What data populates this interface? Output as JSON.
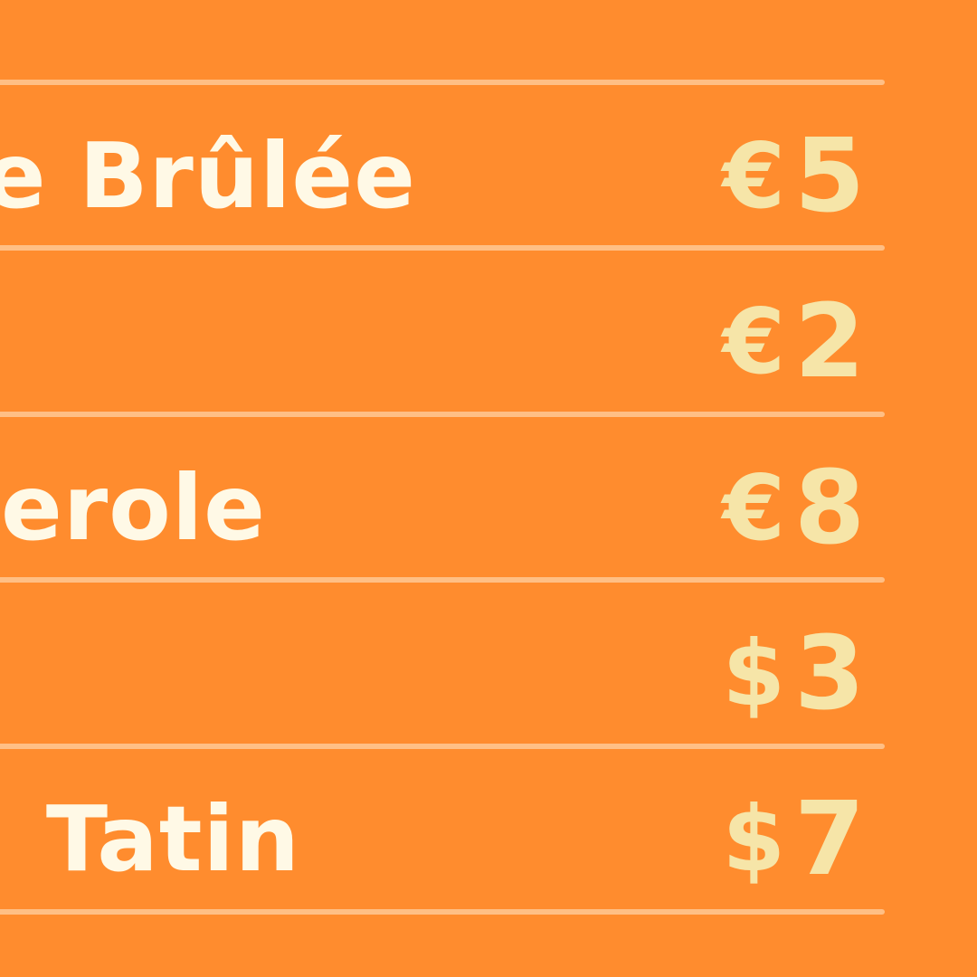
{
  "colors": {
    "background": "#ff8c2e",
    "rule": "#ffbf85",
    "name_text": "#fff9e6",
    "price_text": "#f6e5a8"
  },
  "menu": {
    "items": [
      {
        "name": "e Brûlée",
        "currency": "€",
        "price": "5"
      },
      {
        "name": "",
        "currency": "€",
        "price": "2"
      },
      {
        "name": "erole",
        "currency": "€",
        "price": "8"
      },
      {
        "name": "",
        "currency": "$",
        "price": "3"
      },
      {
        "name": "Tatin",
        "currency": "$",
        "price": "7"
      }
    ]
  }
}
